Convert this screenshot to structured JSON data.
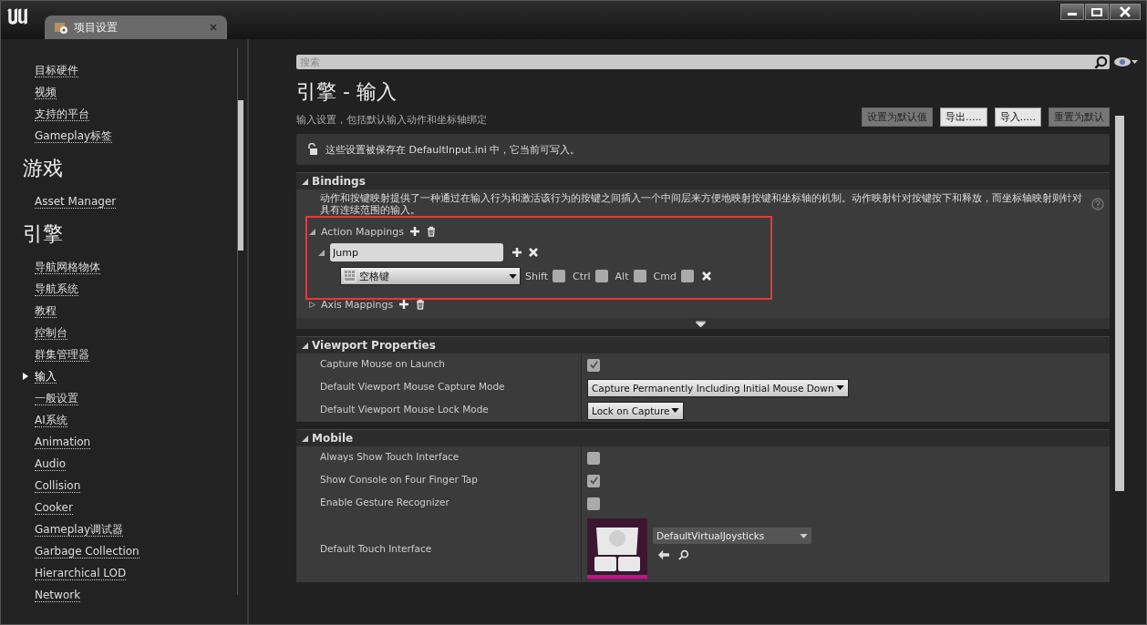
{
  "window": {
    "tab_title": "项目设置"
  },
  "sidebar": {
    "items": [
      {
        "kind": "item",
        "label": "目标硬件",
        "selected": false
      },
      {
        "kind": "item",
        "label": "视频",
        "selected": false
      },
      {
        "kind": "item",
        "label": "支持的平台",
        "selected": false
      },
      {
        "kind": "item",
        "label": "Gameplay标签",
        "selected": false
      },
      {
        "kind": "heading",
        "label": "游戏"
      },
      {
        "kind": "item",
        "label": "Asset Manager",
        "selected": false
      },
      {
        "kind": "heading",
        "label": "引擎"
      },
      {
        "kind": "item",
        "label": "导航网格物体",
        "selected": false
      },
      {
        "kind": "item",
        "label": "导航系统",
        "selected": false
      },
      {
        "kind": "item",
        "label": "教程",
        "selected": false
      },
      {
        "kind": "item",
        "label": "控制台",
        "selected": false
      },
      {
        "kind": "item",
        "label": "群集管理器",
        "selected": false
      },
      {
        "kind": "item",
        "label": "输入",
        "selected": true
      },
      {
        "kind": "item",
        "label": "一般设置",
        "selected": false
      },
      {
        "kind": "item",
        "label": "AI系统",
        "selected": false
      },
      {
        "kind": "item",
        "label": "Animation",
        "selected": false
      },
      {
        "kind": "item",
        "label": "Audio",
        "selected": false
      },
      {
        "kind": "item",
        "label": "Collision",
        "selected": false
      },
      {
        "kind": "item",
        "label": "Cooker",
        "selected": false
      },
      {
        "kind": "item",
        "label": "Gameplay调试器",
        "selected": false
      },
      {
        "kind": "item",
        "label": "Garbage Collection",
        "selected": false
      },
      {
        "kind": "item",
        "label": "Hierarchical LOD",
        "selected": false
      },
      {
        "kind": "item",
        "label": "Network",
        "selected": false
      }
    ]
  },
  "search": {
    "placeholder": "搜索"
  },
  "page": {
    "title": "引擎 - 输入",
    "subtitle": "输入设置，包括默认输入动作和坐标轴绑定",
    "buttons": [
      {
        "label": "设置为默认值",
        "disabled": true
      },
      {
        "label": "导出.....",
        "disabled": false
      },
      {
        "label": "导入.....",
        "disabled": false
      },
      {
        "label": "重置为默认",
        "disabled": true
      }
    ],
    "info": "这些设置被保存在 DefaultInput.ini 中，它当前可写入。"
  },
  "bindings": {
    "title": "Bindings",
    "expanded": true,
    "description": "动作和按键映射提供了一种通过在输入行为和激活该行为的按键之间插入一个中间层来方便地映射按键和坐标轴的机制。动作映射针对按键按下和释放，而坐标轴映射则针对具有连续范围的输入。",
    "action_mappings": {
      "label": "Action Mappings",
      "expanded": true,
      "actions": [
        {
          "name": "Jump",
          "expanded": true,
          "key": "空格键",
          "modifiers": [
            {
              "label": "Shift",
              "checked": false
            },
            {
              "label": "Ctrl",
              "checked": false
            },
            {
              "label": "Alt",
              "checked": false
            },
            {
              "label": "Cmd",
              "checked": false
            }
          ]
        }
      ]
    },
    "axis_mappings": {
      "label": "Axis Mappings",
      "expanded": false
    }
  },
  "sections": [
    {
      "title": "Viewport Properties",
      "expanded": true,
      "rows": [
        {
          "kind": "checkbox",
          "label": "Capture Mouse on Launch",
          "checked": true
        },
        {
          "kind": "dropdown",
          "label": "Default Viewport Mouse Capture Mode",
          "value": "Capture Permanently Including Initial Mouse Down"
        },
        {
          "kind": "dropdown",
          "label": "Default Viewport Mouse Lock Mode",
          "value": "Lock on Capture"
        }
      ]
    },
    {
      "title": "Mobile",
      "expanded": true,
      "rows": [
        {
          "kind": "checkbox",
          "label": "Always Show Touch Interface",
          "checked": false
        },
        {
          "kind": "checkbox",
          "label": "Show Console on Four Finger Tap",
          "checked": true
        },
        {
          "kind": "checkbox",
          "label": "Enable Gesture Recognizer",
          "checked": false
        },
        {
          "kind": "asset",
          "label": "Default Touch Interface",
          "value": "DefaultVirtualJoysticks"
        }
      ]
    }
  ]
}
